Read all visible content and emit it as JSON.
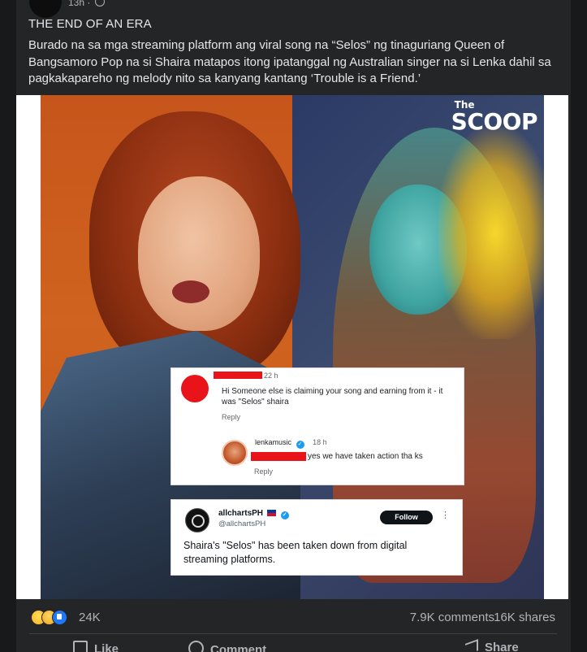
{
  "post": {
    "timestamp": "13h ·",
    "title": "THE END OF AN ERA",
    "body": "Burado na sa mga streaming platform ang viral song na “Selos” ng tinaguriang Queen of Bangsamoro Pop na si Shaira matapos itong ipatanggal ng Australian singer na si Lenka dahil sa pagkakapareho ng melody nito sa kanyang kantang ‘Trouble is a Friend.’"
  },
  "image": {
    "logo_small": "The",
    "logo_big": "SCOOP",
    "comment": {
      "time": "22 h",
      "text": "Hi Someone else is claiming your song and earning from it - it was \"Selos\" shaira",
      "reply": "Reply",
      "reply_user": "lenkamusic",
      "reply_time": "18 h",
      "reply_text": "yes we have taken action tha ks",
      "reply_reply": "Reply"
    },
    "tweet": {
      "name": "allchartsPH",
      "handle": "@allchartsPH",
      "follow": "Follow",
      "more": "⋮",
      "text": "Shaira's \"Selos\" has been taken down from digital streaming platforms."
    }
  },
  "stats": {
    "reactions": "24K",
    "comments": "7.9K comments",
    "shares": "16K shares"
  },
  "actions": {
    "like": "Like",
    "comment": "Comment",
    "share": "Share"
  }
}
